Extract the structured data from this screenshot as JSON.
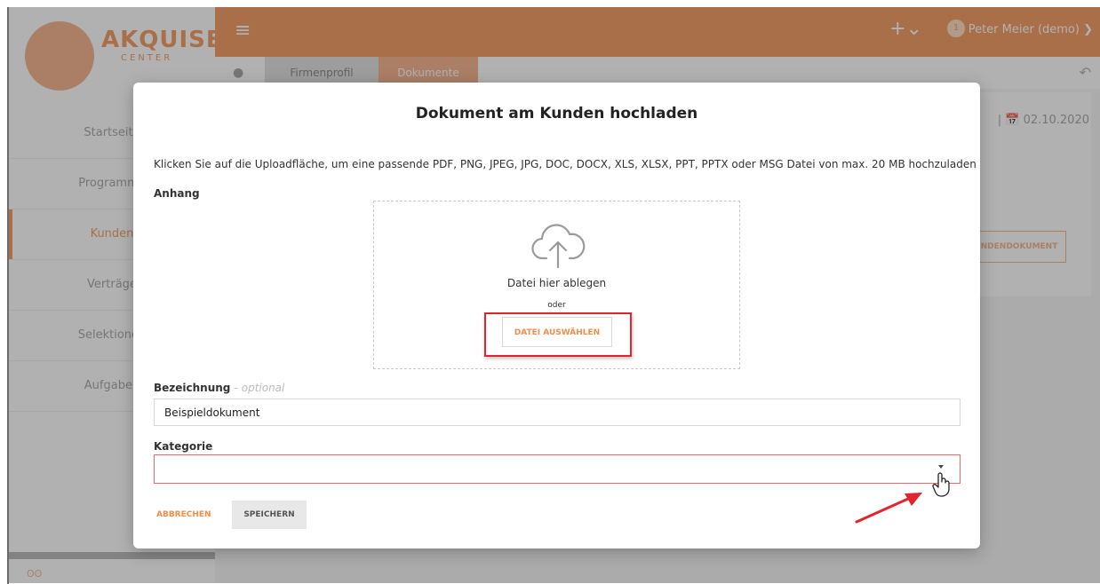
{
  "app": {
    "logo_text": "AKQUISE",
    "logo_sub": "CENTER",
    "user_name": "Peter Meier (demo) ❯",
    "notification_count": "1",
    "menu_icon": "hamburger-icon",
    "add_icon": "plus-icon",
    "bell_icon": "bell-icon"
  },
  "sidebar": {
    "items": [
      {
        "label": "Startseite"
      },
      {
        "label": "Programme"
      },
      {
        "label": "Kunden"
      },
      {
        "label": "Verträge"
      },
      {
        "label": "Selektionen"
      },
      {
        "label": "Aufgaben"
      }
    ],
    "active_index": 2
  },
  "breadcrumb": {
    "items": [
      {
        "label": "Firmenprofil"
      },
      {
        "label": "Dokumente"
      }
    ]
  },
  "background": {
    "date": "| 📅 02.10.2020",
    "document_button": "NDENDOKUMENT"
  },
  "modal": {
    "title": "Dokument am Kunden hochladen",
    "description": "Klicken Sie auf die Uploadfläche, um eine passende PDF, PNG, JPEG, JPG, DOC, DOCX, XLS, XLSX, PPT, PPTX oder MSG Datei von max. 20 MB hochzuladen",
    "attachment_label": "Anhang",
    "dropzone": {
      "drop_text": "Datei hier ablegen",
      "or_text": "oder",
      "choose_button": "DATEI AUSWÄHLEN"
    },
    "name_label": "Bezeichnung",
    "name_optional": "- optional",
    "name_value": "Beispieldokument",
    "category_label": "Kategorie",
    "category_value": "",
    "cancel_button": "ABBRECHEN",
    "save_button": "SPEICHERN"
  },
  "colors": {
    "accent": "#f08e4d",
    "highlight": "#e0262c"
  }
}
